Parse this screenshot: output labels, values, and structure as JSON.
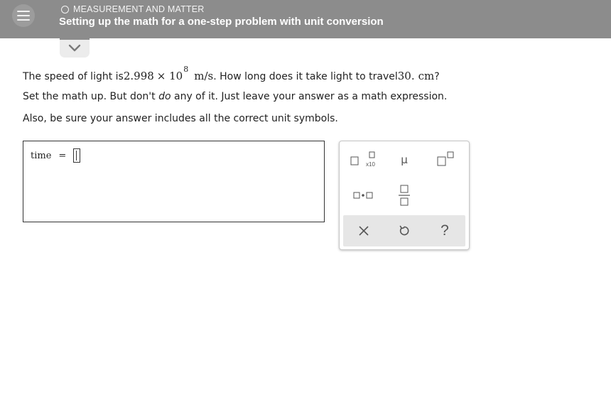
{
  "header": {
    "topic": "MEASUREMENT AND MATTER",
    "title": "Setting up the math for a one-step problem with unit conversion"
  },
  "problem": {
    "line1_lead": "The speed of light is ",
    "mantissa": "2.998",
    "times_ten": "× 10",
    "exponent": "8",
    "speed_unit": "m/s",
    "line1_middle": ". How long does it take light to travel ",
    "distance": "30.",
    "distance_unit": "cm",
    "line1_end": "?",
    "line2_lead": "Set the math up. But don't ",
    "line2_emph": "do",
    "line2_end": " any of it. Just leave your answer as a math expression.",
    "line3": "Also, be sure your answer includes all the correct unit symbols."
  },
  "answer": {
    "variable": "time",
    "equals": "="
  },
  "keypad": {
    "x10_label": "x10",
    "mu_label": "μ",
    "help_label": "?"
  },
  "colors": {
    "header_bg": "#8c8c8c",
    "keypad_bar": "#e6e6e6"
  }
}
